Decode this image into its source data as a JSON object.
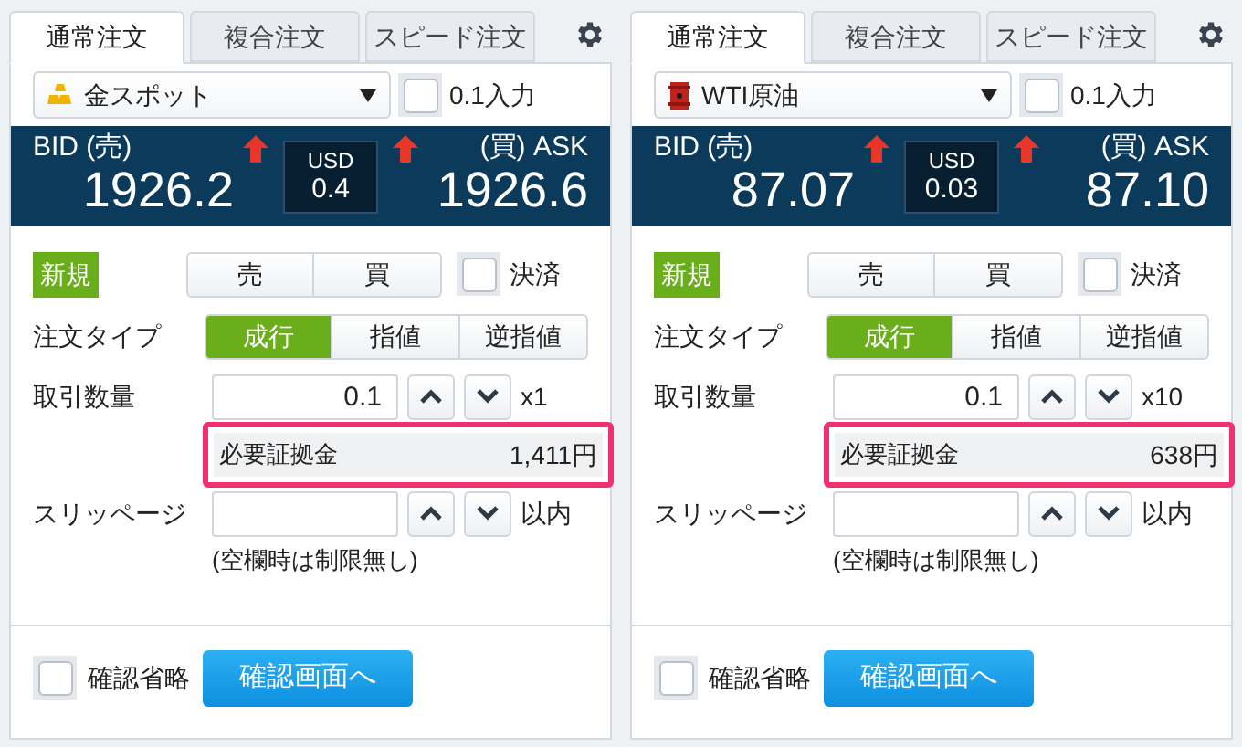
{
  "panels": [
    {
      "tabs": [
        {
          "label": "通常注文",
          "selected": true
        },
        {
          "label": "複合注文",
          "selected": false
        },
        {
          "label": "スピード注文",
          "selected": false
        }
      ],
      "symbol": {
        "kind": "gold",
        "name": "金スポット"
      },
      "decimal_input": {
        "label": "0.1入力",
        "checked": false
      },
      "quote": {
        "bid_label": "BID (売)",
        "bid": "1926.2",
        "spread_currency": "USD",
        "spread": "0.4",
        "ask_label": "(買) ASK",
        "ask": "1926.6"
      },
      "new_label": "新規",
      "sides": [
        {
          "label": "売",
          "selected": false
        },
        {
          "label": "買",
          "selected": false
        }
      ],
      "settle": {
        "label": "決済",
        "checked": false
      },
      "order_type": {
        "label": "注文タイプ",
        "options": [
          {
            "label": "成行",
            "selected": true
          },
          {
            "label": "指値",
            "selected": false
          },
          {
            "label": "逆指値",
            "selected": false
          }
        ]
      },
      "quantity": {
        "label": "取引数量",
        "value": "0.1",
        "multiplier": "x1"
      },
      "margin": {
        "label": "必要証拠金",
        "value": "1,411円"
      },
      "slippage": {
        "label": "スリッページ",
        "unit": "以内",
        "note": "(空欄時は制限無し)"
      },
      "skip_confirm": {
        "label": "確認省略",
        "checked": false
      },
      "confirm_button": "確認画面へ"
    },
    {
      "tabs": [
        {
          "label": "通常注文",
          "selected": true
        },
        {
          "label": "複合注文",
          "selected": false
        },
        {
          "label": "スピード注文",
          "selected": false
        }
      ],
      "symbol": {
        "kind": "oil",
        "name": "WTI原油"
      },
      "decimal_input": {
        "label": "0.1入力",
        "checked": false
      },
      "quote": {
        "bid_label": "BID (売)",
        "bid": "87.07",
        "spread_currency": "USD",
        "spread": "0.03",
        "ask_label": "(買) ASK",
        "ask": "87.10"
      },
      "new_label": "新規",
      "sides": [
        {
          "label": "売",
          "selected": false
        },
        {
          "label": "買",
          "selected": false
        }
      ],
      "settle": {
        "label": "決済",
        "checked": false
      },
      "order_type": {
        "label": "注文タイプ",
        "options": [
          {
            "label": "成行",
            "selected": true
          },
          {
            "label": "指値",
            "selected": false
          },
          {
            "label": "逆指値",
            "selected": false
          }
        ]
      },
      "quantity": {
        "label": "取引数量",
        "value": "0.1",
        "multiplier": "x10"
      },
      "margin": {
        "label": "必要証拠金",
        "value": "638円"
      },
      "slippage": {
        "label": "スリッページ",
        "unit": "以内",
        "note": "(空欄時は制限無し)"
      },
      "skip_confirm": {
        "label": "確認省略",
        "checked": false
      },
      "confirm_button": "確認画面へ"
    }
  ]
}
